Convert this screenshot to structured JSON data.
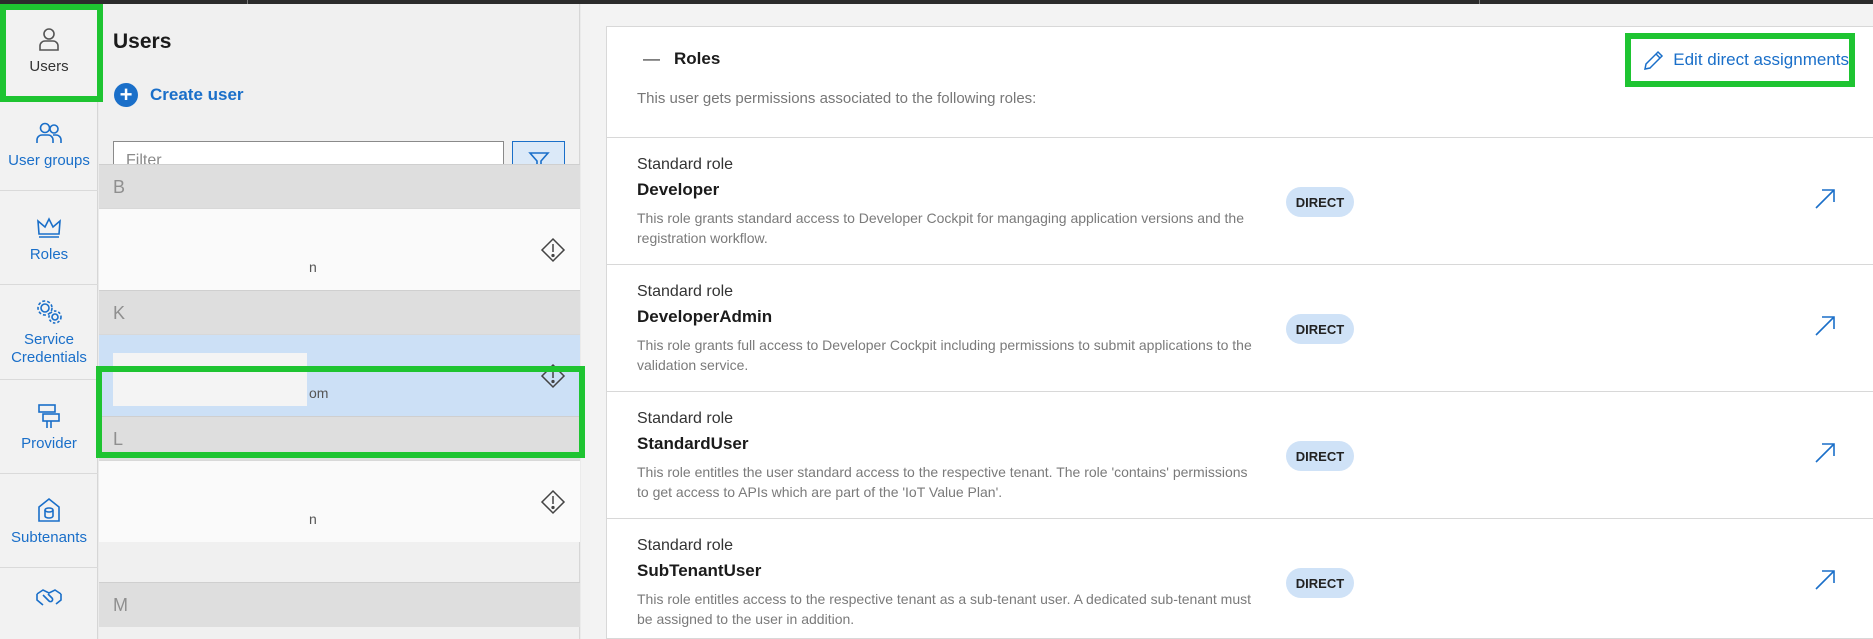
{
  "nav": {
    "items": [
      {
        "label": "Users",
        "icon": "user-icon"
      },
      {
        "label": "User groups",
        "icon": "user-group-icon"
      },
      {
        "label": "Roles",
        "icon": "crown-icon"
      },
      {
        "label": "Service Credentials",
        "icon": "gears-icon"
      },
      {
        "label": "Provider",
        "icon": "provider-icon"
      },
      {
        "label": "Subtenants",
        "icon": "subtenant-icon"
      },
      {
        "label": "",
        "icon": "handshake-icon"
      }
    ]
  },
  "users_panel": {
    "title": "Users",
    "create_label": "Create user",
    "filter_placeholder": "Filter",
    "groups": [
      {
        "letter": "B",
        "email_fragment": "n"
      },
      {
        "letter": "K",
        "email_fragment": "om"
      },
      {
        "letter": "L",
        "email_fragment": "n"
      },
      {
        "letter": "M"
      }
    ]
  },
  "roles_section": {
    "title": "Roles",
    "collapse_symbol": "—",
    "subtitle": "This user gets permissions associated to the following roles:",
    "edit_label": "Edit direct assignments",
    "roles": [
      {
        "kind": "Standard role",
        "name": "Developer",
        "description": "This role grants standard access to Developer Cockpit for mangaging application versions and the registration workflow.",
        "badge": "DIRECT"
      },
      {
        "kind": "Standard role",
        "name": "DeveloperAdmin",
        "description": "This role grants full access to Developer Cockpit including permissions to submit applications to the validation service.",
        "badge": "DIRECT"
      },
      {
        "kind": "Standard role",
        "name": "StandardUser",
        "description": "This role entitles the user standard access to the respective tenant. The role 'contains' permissions to get access to APIs which are part of the 'IoT Value Plan'.",
        "badge": "DIRECT"
      },
      {
        "kind": "Standard role",
        "name": "SubTenantUser",
        "description": "This role entitles access to the respective tenant as a sub-tenant user. A dedicated sub-tenant must be assigned to the user in addition.",
        "badge": "DIRECT"
      }
    ]
  },
  "colors": {
    "accent": "#1a6fc9",
    "highlight": "#1ec431",
    "selected_row": "#cce0f6",
    "badge_bg": "#cfe2f7"
  }
}
